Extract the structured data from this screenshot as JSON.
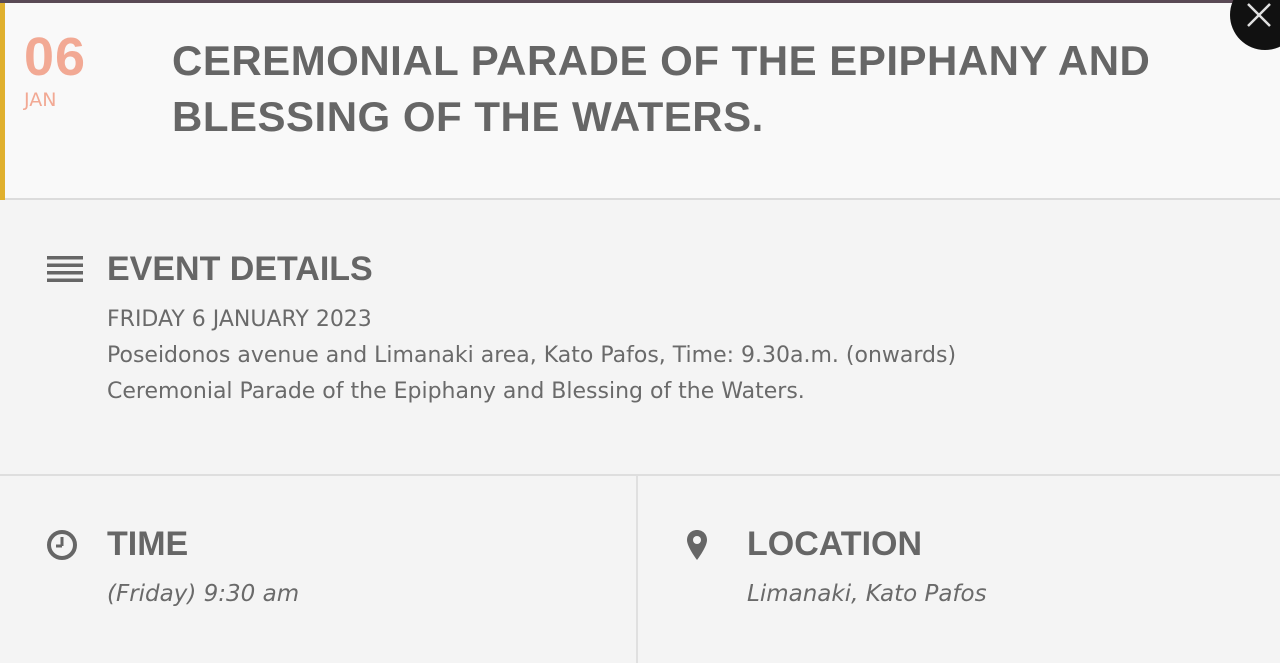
{
  "event": {
    "day": "06",
    "month": "JAN",
    "title": "CEREMONIAL PARADE OF THE EPIPHANY AND BLESSING OF THE WATERS."
  },
  "details": {
    "heading": "EVENT DETAILS",
    "icon": "list-icon",
    "lines": [
      "FRIDAY 6 JANUARY 2023",
      "Poseidonos avenue and Limanaki area, Kato Pafos, Time: 9.30a.m. (onwards)",
      "Ceremonial Parade of the Epiphany and Blessing of the Waters."
    ]
  },
  "time": {
    "heading": "TIME",
    "icon": "clock-icon",
    "value": "(Friday) 9:30 am"
  },
  "location": {
    "heading": "LOCATION",
    "icon": "map-pin-icon",
    "value": "Limanaki, Kato Pafos"
  },
  "colors": {
    "accent": "#e0b02e",
    "date": "#f2a994",
    "text": "#666666",
    "close_button": "#111111"
  }
}
